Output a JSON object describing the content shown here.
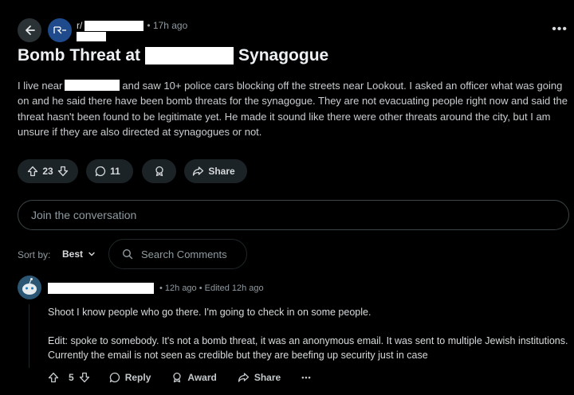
{
  "header": {
    "subreddit_prefix": "r/",
    "time_ago": "• 17h ago",
    "more_label": "•••"
  },
  "post": {
    "title_start": "Bomb Threat at",
    "title_end": "Synagogue",
    "body_start": "I live near",
    "body_rest": "and saw 10+ police cars blocking off the streets near Lookout. I asked an officer what was going on and he said there have been bomb threats for the synagogue. They are not evacuating people right now and said the threat hasn't been found to be legitimate yet. He made it sound like there were other threats around the city, but I am unsure if they are also directed at synagogues or not.",
    "vote_count": "23",
    "comment_count": "11",
    "share_label": "Share"
  },
  "join": {
    "placeholder": "Join the conversation"
  },
  "sort": {
    "label": "Sort by:",
    "value": "Best",
    "search_placeholder": "Search Comments"
  },
  "comment": {
    "meta": "• 12h ago • Edited 12h ago",
    "line1": "Shoot I know people who go there. I'm going to check in on some people.",
    "line2": "Edit: spoke to somebody. It's not a bomb threat, it was an anonymous email. It was sent to multiple Jewish institutions. Currently the email is not seen as credible but they are beefing up security just in case",
    "vote_count": "5",
    "reply_label": "Reply",
    "award_label": "Award",
    "share_label": "Share",
    "more_label": "•••"
  },
  "colors": {
    "background": "#000000",
    "pill": "#1c2326",
    "subreddit_icon": "#1f4b8c"
  }
}
